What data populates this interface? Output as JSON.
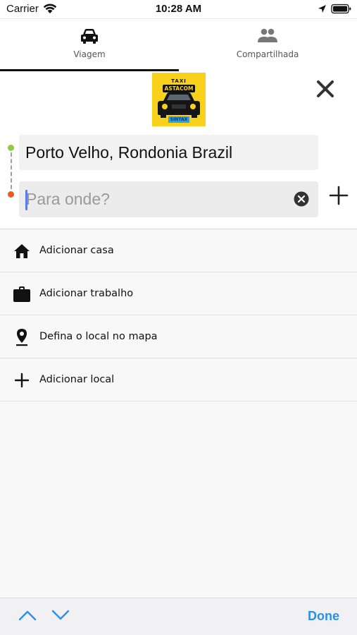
{
  "status_bar": {
    "carrier": "Carrier",
    "time": "10:28 AM"
  },
  "tabs": [
    {
      "label": "Viagem",
      "icon": "car-icon",
      "selected": true
    },
    {
      "label": "Compartilhada",
      "icon": "people-icon",
      "selected": false
    }
  ],
  "logo": {
    "taxi_text": "TAXI",
    "name_text": "ASTACOM",
    "tag_text": "SINTAX"
  },
  "route": {
    "origin_value": "Porto Velho, Rondonia Brazil",
    "destination_value": "",
    "destination_placeholder": "Para onde?"
  },
  "shortcuts": [
    {
      "label": "Adicionar casa",
      "icon": "home-icon"
    },
    {
      "label": "Adicionar trabalho",
      "icon": "briefcase-icon"
    },
    {
      "label": "Defina o local no mapa",
      "icon": "map-pin-icon"
    },
    {
      "label": "Adicionar local",
      "icon": "plus-icon"
    }
  ],
  "keyboard_accessory": {
    "done_label": "Done"
  },
  "colors": {
    "accent": "#2a8ff0",
    "origin_dot": "#8ccf3e",
    "destination_dot": "#ec5a23",
    "logo_background": "#f7d11c"
  }
}
